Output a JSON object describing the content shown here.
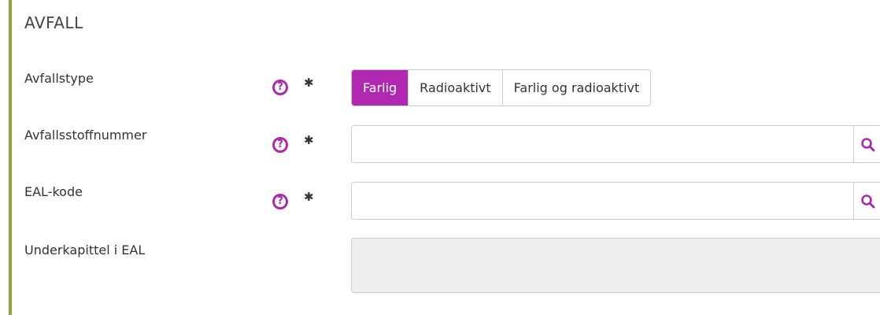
{
  "section": {
    "title": "AVFALL"
  },
  "fields": {
    "avfallstype": {
      "label": "Avfallstype",
      "help_icon": "question-circle-icon",
      "required_mark": "✱",
      "options": [
        "Farlig",
        "Radioaktivt",
        "Farlig og radioaktivt"
      ],
      "selected": "Farlig"
    },
    "avfallsstoffnummer": {
      "label": "Avfallsstoffnummer",
      "help_icon": "question-circle-icon",
      "required_mark": "✱",
      "value": "",
      "action_icon": "search-icon"
    },
    "eal_kode": {
      "label": "EAL-kode",
      "help_icon": "question-circle-icon",
      "required_mark": "✱",
      "value": "",
      "action_icon": "search-icon"
    },
    "underkapittel": {
      "label": "Underkapittel i EAL",
      "value": ""
    }
  },
  "colors": {
    "accent": "#b028b0",
    "section_rule": "#8ea834",
    "readonly_bg": "#eeeeee",
    "border": "#cccccc"
  }
}
